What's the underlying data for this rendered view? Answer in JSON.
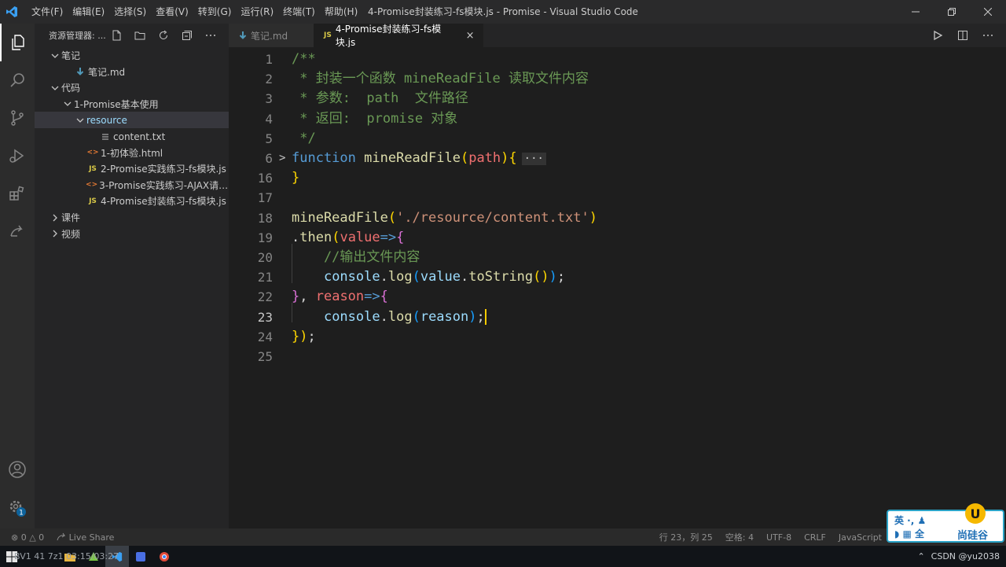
{
  "window": {
    "title": "4-Promise封装练习-fs模块.js - Promise - Visual Studio Code",
    "menu": [
      "文件(F)",
      "编辑(E)",
      "选择(S)",
      "查看(V)",
      "转到(G)",
      "运行(R)",
      "终端(T)",
      "帮助(H)"
    ]
  },
  "sidebar": {
    "title": "资源管理器: ...",
    "tree": [
      {
        "label": "笔记",
        "twisty": "v",
        "icon": ""
      },
      {
        "label": "笔记.md",
        "twisty": "",
        "icon": "md"
      },
      {
        "label": "代码",
        "twisty": "v",
        "icon": ""
      },
      {
        "label": "1-Promise基本使用",
        "twisty": "v",
        "icon": ""
      },
      {
        "label": "resource",
        "twisty": "v",
        "icon": ""
      },
      {
        "label": "content.txt",
        "twisty": "",
        "icon": "txt"
      },
      {
        "label": "1-初体验.html",
        "twisty": "",
        "icon": "html"
      },
      {
        "label": "2-Promise实践练习-fs模块.js",
        "twisty": "",
        "icon": "js"
      },
      {
        "label": "3-Promise实践练习-AJAX请求...",
        "twisty": "",
        "icon": "html"
      },
      {
        "label": "4-Promise封装练习-fs模块.js",
        "twisty": "",
        "icon": "js"
      },
      {
        "label": "课件",
        "twisty": ">",
        "icon": ""
      },
      {
        "label": "视频",
        "twisty": ">",
        "icon": ""
      }
    ]
  },
  "tabs": [
    {
      "label": "笔记.md"
    },
    {
      "label": "4-Promise封装练习-fs模块.js",
      "close": "×"
    }
  ],
  "icon_labels": {
    "js": "JS",
    "html": "<>"
  },
  "editor": {
    "lines": [
      {
        "n": "1",
        "tokens": [
          {
            "t": "/**",
            "c": "cm"
          }
        ]
      },
      {
        "n": "2",
        "tokens": [
          {
            "t": " * 封装一个函数 mineReadFile 读取文件内容",
            "c": "cm"
          }
        ]
      },
      {
        "n": "3",
        "tokens": [
          {
            "t": " * 参数:  path  文件路径",
            "c": "cm"
          }
        ]
      },
      {
        "n": "4",
        "tokens": [
          {
            "t": " * 返回:  promise 对象",
            "c": "cm"
          }
        ]
      },
      {
        "n": "5",
        "tokens": [
          {
            "t": " */",
            "c": "cm"
          }
        ]
      },
      {
        "n": "6",
        "tokens": [
          {
            "t": "function",
            "c": "kw"
          },
          {
            "t": " ",
            "c": "pu"
          },
          {
            "t": "mineReadFile",
            "c": "fn"
          },
          {
            "t": "(",
            "c": "br1"
          },
          {
            "t": "path",
            "c": "pmr"
          },
          {
            "t": ")",
            "c": "br1"
          },
          {
            "t": "{",
            "c": "br1"
          },
          {
            "t": "···",
            "c": "fold-dots"
          }
        ],
        "fold": ">"
      },
      {
        "n": "16",
        "tokens": [
          {
            "t": "}",
            "c": "br1"
          }
        ]
      },
      {
        "n": "17",
        "tokens": []
      },
      {
        "n": "18",
        "tokens": [
          {
            "t": "mineReadFile",
            "c": "fn"
          },
          {
            "t": "(",
            "c": "br1"
          },
          {
            "t": "'./resource/content.txt'",
            "c": "st"
          },
          {
            "t": ")",
            "c": "br1"
          }
        ]
      },
      {
        "n": "19",
        "tokens": [
          {
            "t": ".",
            "c": "pu"
          },
          {
            "t": "then",
            "c": "fn"
          },
          {
            "t": "(",
            "c": "br1"
          },
          {
            "t": "value",
            "c": "pmr"
          },
          {
            "t": "=>",
            "c": "kw"
          },
          {
            "t": "{",
            "c": "br2"
          }
        ]
      },
      {
        "n": "20",
        "tokens": [
          {
            "t": "    //输出文件内容",
            "c": "cm"
          }
        ]
      },
      {
        "n": "21",
        "tokens": [
          {
            "t": "    ",
            "c": "pu"
          },
          {
            "t": "console",
            "c": "pm"
          },
          {
            "t": ".",
            "c": "pu"
          },
          {
            "t": "log",
            "c": "fn"
          },
          {
            "t": "(",
            "c": "br3"
          },
          {
            "t": "value",
            "c": "pm"
          },
          {
            "t": ".",
            "c": "pu"
          },
          {
            "t": "toString",
            "c": "fn"
          },
          {
            "t": "()",
            "c": "br1"
          },
          {
            "t": ")",
            "c": "br3"
          },
          {
            "t": ";",
            "c": "pu"
          }
        ]
      },
      {
        "n": "22",
        "tokens": [
          {
            "t": "}",
            "c": "br2"
          },
          {
            "t": ", ",
            "c": "pu"
          },
          {
            "t": "reason",
            "c": "pmr"
          },
          {
            "t": "=>",
            "c": "kw"
          },
          {
            "t": "{",
            "c": "br2"
          }
        ]
      },
      {
        "n": "23",
        "tokens": [
          {
            "t": "    ",
            "c": "pu"
          },
          {
            "t": "console",
            "c": "pm"
          },
          {
            "t": ".",
            "c": "pu"
          },
          {
            "t": "log",
            "c": "fn"
          },
          {
            "t": "(",
            "c": "br3"
          },
          {
            "t": "reason",
            "c": "pm"
          },
          {
            "t": ")",
            "c": "br3"
          },
          {
            "t": ";",
            "c": "pu"
          }
        ],
        "cursor": true
      },
      {
        "n": "24",
        "tokens": [
          {
            "t": "}",
            "c": "br1"
          },
          {
            "t": ")",
            "c": "br1"
          },
          {
            "t": ";",
            "c": "pu"
          }
        ]
      },
      {
        "n": "25",
        "tokens": []
      }
    ]
  },
  "statusbar": {
    "problems": "⊗ 0 △ 0",
    "live_share": "Live Share",
    "position": "行 23，列 25",
    "indent": "空格: 4",
    "encoding": "UTF-8",
    "eol": "CRLF",
    "language": "JavaScript"
  },
  "taskbar": {
    "overlay": "BV1  41  7z1  03:15/03:27",
    "tray": "CSDN @yu2038"
  },
  "badge": {
    "ime_top": "英 ·, ♟",
    "ime_bottom": "◗ ▦ 全",
    "brand": "尚硅谷",
    "logo": "U"
  },
  "colors": {
    "accent": "#007acc",
    "cursor": "#ffcc00",
    "badge_border": "#2aa3c7"
  }
}
